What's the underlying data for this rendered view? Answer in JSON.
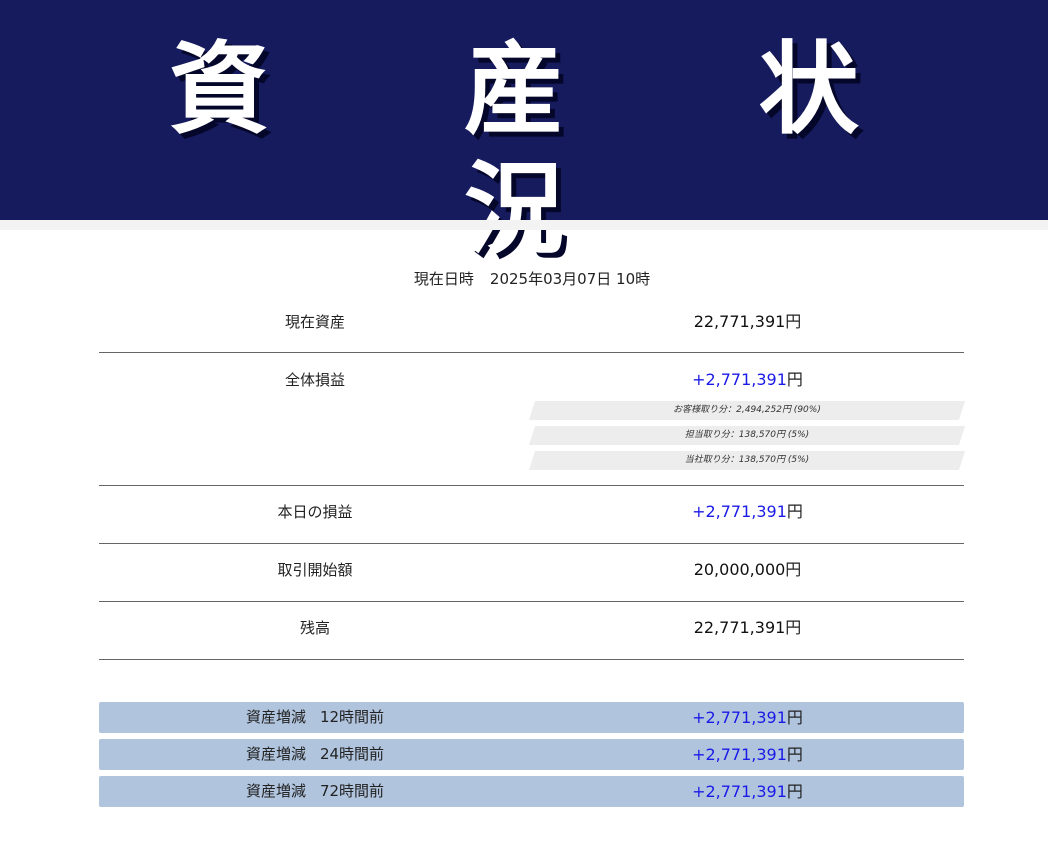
{
  "header": {
    "title": "資 産 状 況",
    "background_color": "#161b5e"
  },
  "datetime": {
    "label": "現在日時",
    "value": "2025年03月07日 10時"
  },
  "rows": {
    "current_assets": {
      "label": "現在資産",
      "value": "22,771,391",
      "unit": "円"
    },
    "total_pl": {
      "label": "全体損益",
      "value": "+2,771,391",
      "unit": "円",
      "breakdown": [
        "お客様取り分：2,494,252円 (90%)",
        "担当取り分：138,570円 (5%)",
        "当社取り分：138,570円 (5%)"
      ]
    },
    "today_pl": {
      "label": "本日の損益",
      "value": "+2,771,391",
      "unit": "円"
    },
    "start_amount": {
      "label": "取引開始額",
      "value": "20,000,000",
      "unit": "円"
    },
    "balance": {
      "label": "残高",
      "value": "22,771,391",
      "unit": "円"
    }
  },
  "changes": [
    {
      "label": "資産増減",
      "period": "12時間前",
      "value": "+2,771,391",
      "unit": "円"
    },
    {
      "label": "資産増減",
      "period": "24時間前",
      "value": "+2,771,391",
      "unit": "円"
    },
    {
      "label": "資産増減",
      "period": "72時間前",
      "value": "+2,771,391",
      "unit": "円"
    }
  ],
  "colors": {
    "positive": "#1a1ae6",
    "band": "#b0c4de",
    "header": "#161b5e"
  }
}
